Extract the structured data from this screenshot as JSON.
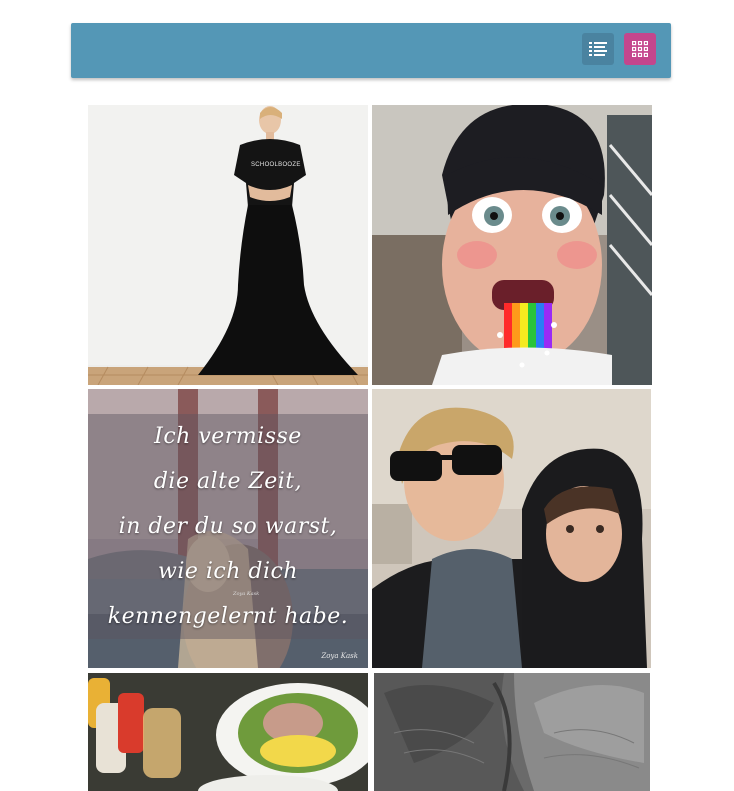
{
  "toolbar": {
    "accent_color": "#5497b6",
    "buttons": [
      {
        "name": "list-view-button",
        "icon": "list-icon",
        "active": false,
        "color": "#4a83a0"
      },
      {
        "name": "grid-view-button",
        "icon": "grid-icon",
        "active": true,
        "color": "#c4468d"
      }
    ]
  },
  "gallery": {
    "layout": "grid",
    "columns": 2,
    "photos": [
      {
        "subject": "woman-black-gown",
        "shirt_text": "SCHOOLBOOZE"
      },
      {
        "subject": "man-rainbow-snapchat-filter"
      },
      {
        "subject": "quote-golden-gate",
        "quote_lines": [
          "Ich vermisse",
          "die alte Zeit,",
          "in der du so warst,",
          "wie ich dich",
          "kennengelernt habe."
        ],
        "signature": "Zoya Kask",
        "signature_small": "Zoya Kask"
      },
      {
        "subject": "two-young-men-selfie"
      },
      {
        "subject": "food-salad-table"
      },
      {
        "subject": "elephants-black-white"
      }
    ]
  }
}
